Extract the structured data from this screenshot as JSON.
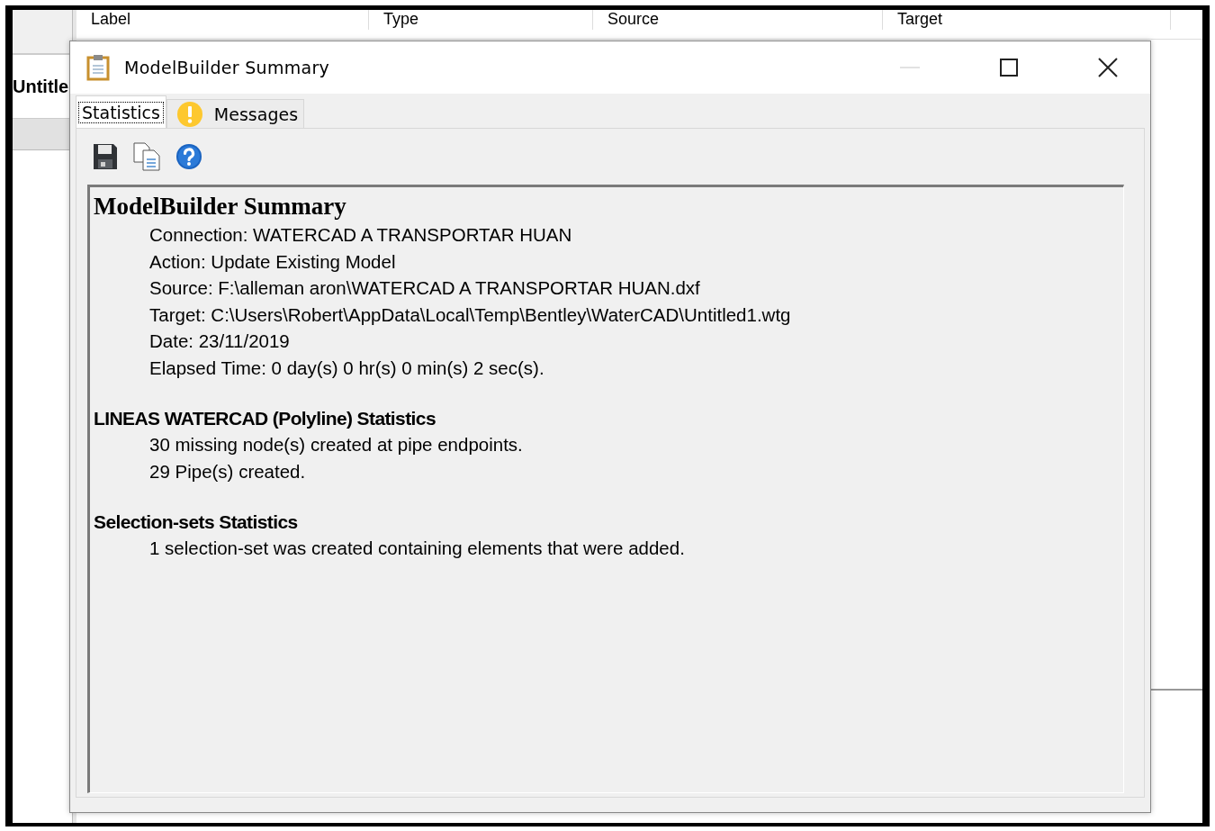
{
  "background": {
    "columns": [
      "Label",
      "Type",
      "Source",
      "Target"
    ],
    "document_tab": "Untitle"
  },
  "dialog": {
    "title": "ModelBuilder Summary",
    "controls": [
      {
        "kind": "minimize",
        "disabled": true
      },
      {
        "kind": "maximize",
        "disabled": false
      },
      {
        "kind": "close",
        "disabled": false
      }
    ],
    "tabs": [
      {
        "label": "Statistics",
        "selected": true,
        "kind": "plain"
      },
      {
        "label": "Messages",
        "selected": false,
        "kind": "warning"
      }
    ],
    "toolbar": [
      {
        "kind": "save"
      },
      {
        "kind": "copy"
      },
      {
        "kind": "help"
      }
    ],
    "report": {
      "title": "ModelBuilder Summary",
      "lines": [
        "Connection: WATERCAD A TRANSPORTAR HUAN",
        "Action: Update Existing Model",
        "Source: F:\\alleman aron\\WATERCAD A TRANSPORTAR HUAN.dxf",
        "Target: C:\\Users\\Robert\\AppData\\Local\\Temp\\Bentley\\WaterCAD\\Untitled1.wtg",
        "Date: 23/11/2019",
        "Elapsed Time: 0 day(s) 0 hr(s) 0 min(s) 2 sec(s)."
      ],
      "sections": [
        {
          "heading": "LINEAS WATERCAD (Polyline) Statistics",
          "lines": [
            "30 missing node(s) created at pipe endpoints.",
            "29 Pipe(s) created."
          ]
        },
        {
          "heading": "Selection-sets Statistics",
          "lines": [
            "1 selection-set was created containing elements that were added."
          ]
        }
      ]
    }
  }
}
